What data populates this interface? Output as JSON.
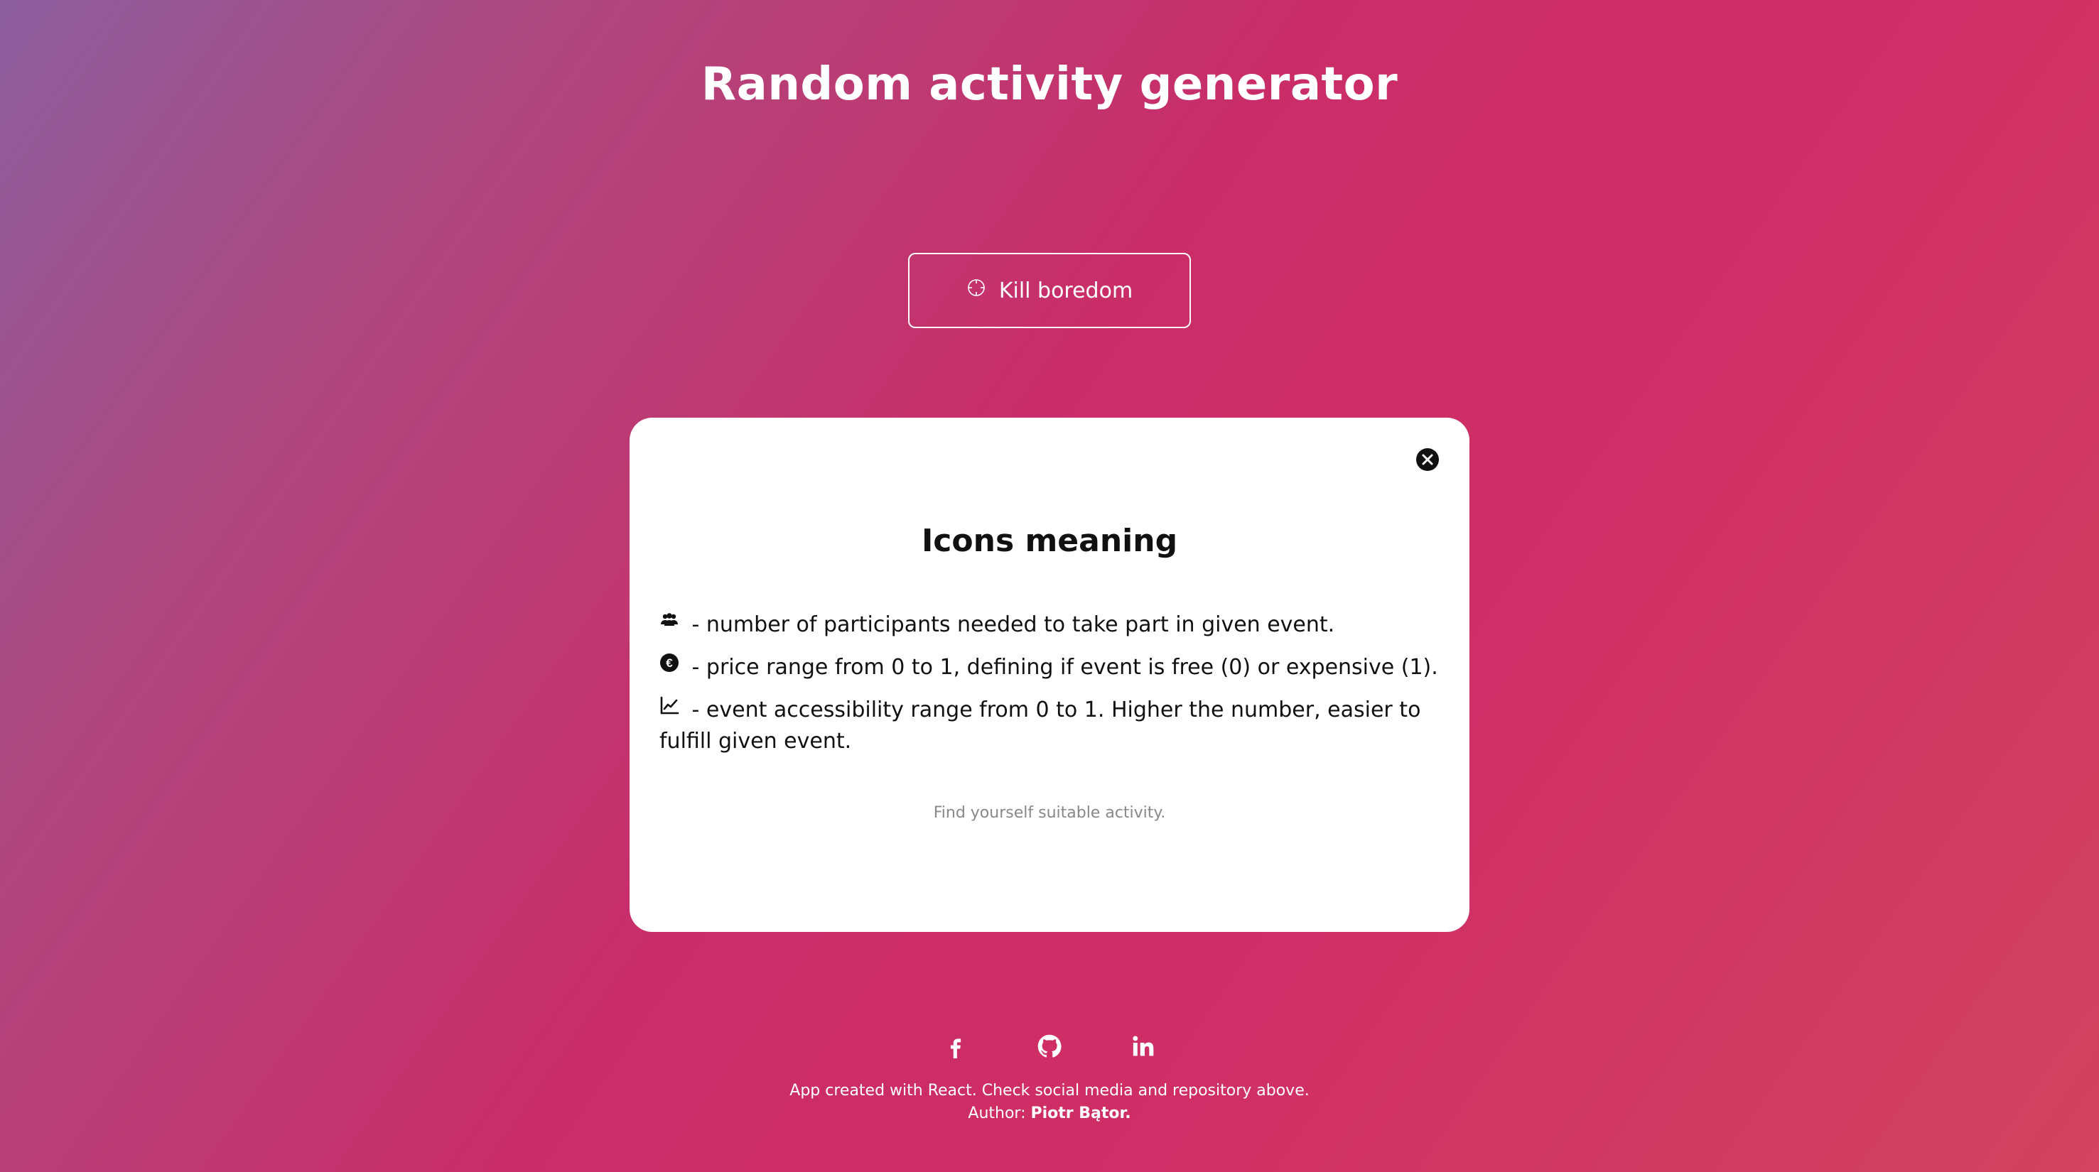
{
  "header": {
    "title": "Random activity generator"
  },
  "action": {
    "button_label": "Kill boredom",
    "button_icon": "target-icon"
  },
  "modal": {
    "title": "Icons meaning",
    "items": [
      {
        "icon": "participants-icon",
        "text": "- number of participants needed to take part in given event."
      },
      {
        "icon": "euro-icon",
        "text": "- price range from 0 to 1, defining if event is free (0) or expensive (1)."
      },
      {
        "icon": "chart-line-icon",
        "text": "- event accessibility range from 0 to 1. Higher the number, easier to fulfill given event."
      }
    ],
    "hint": "Find yourself suitable activity.",
    "close_icon": "close-icon"
  },
  "social": [
    {
      "name": "facebook-icon"
    },
    {
      "name": "github-icon"
    },
    {
      "name": "linkedin-icon"
    }
  ],
  "footer": {
    "line1": "App created with React. Check social media and repository above.",
    "author_label": "Author:",
    "author_name": "Piotr Bątor."
  },
  "colors": {
    "gradient_start": "#8c5e9e",
    "gradient_mid": "#c92d68",
    "gradient_end": "#d24460",
    "modal_bg": "#ffffff",
    "hint_text": "#888888"
  }
}
